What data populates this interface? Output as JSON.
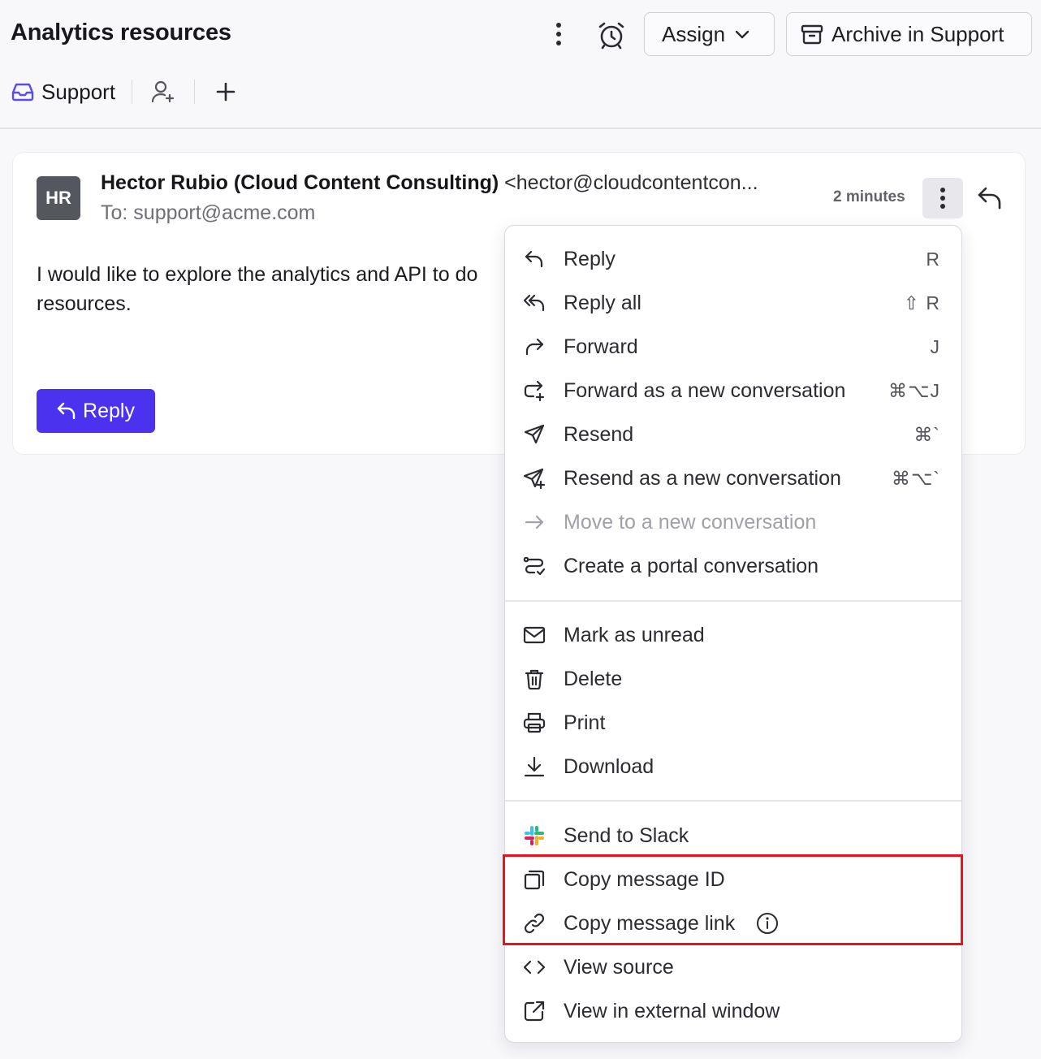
{
  "header": {
    "title": "Analytics resources",
    "assign_label": "Assign",
    "archive_label": "Archive in Support"
  },
  "tabs": {
    "inbox_label": "Support"
  },
  "message": {
    "avatar_initials": "HR",
    "sender_name": "Hector Rubio (Cloud Content Consulting)",
    "sender_email": "<hector@cloudcontentcon...",
    "recipient": "To: support@acme.com",
    "time": "2 minutes",
    "body": "I would like to explore the analytics and API to do",
    "body_line2": "resources.",
    "reply_label": "Reply"
  },
  "menu": {
    "reply": {
      "label": "Reply",
      "shortcut": "R"
    },
    "reply_all": {
      "label": "Reply all",
      "shortcut": "⇧ R"
    },
    "forward": {
      "label": "Forward",
      "shortcut": "J"
    },
    "forward_new": {
      "label": "Forward as a new conversation",
      "shortcut": "⌘⌥J"
    },
    "resend": {
      "label": "Resend",
      "shortcut": "⌘`"
    },
    "resend_new": {
      "label": "Resend as a new conversation",
      "shortcut": "⌘⌥`"
    },
    "move_new": {
      "label": "Move to a new conversation"
    },
    "portal": {
      "label": "Create a portal conversation"
    },
    "mark_unread": {
      "label": "Mark as unread"
    },
    "delete": {
      "label": "Delete"
    },
    "print": {
      "label": "Print"
    },
    "download": {
      "label": "Download"
    },
    "slack": {
      "label": "Send to Slack"
    },
    "copy_id": {
      "label": "Copy message ID"
    },
    "copy_link": {
      "label": "Copy message link"
    },
    "view_source": {
      "label": "View source"
    },
    "view_external": {
      "label": "View in external window"
    }
  },
  "colors": {
    "primary": "#4b32ee",
    "highlight": "#e8141b",
    "inbox_icon": "#5b4cf0"
  }
}
